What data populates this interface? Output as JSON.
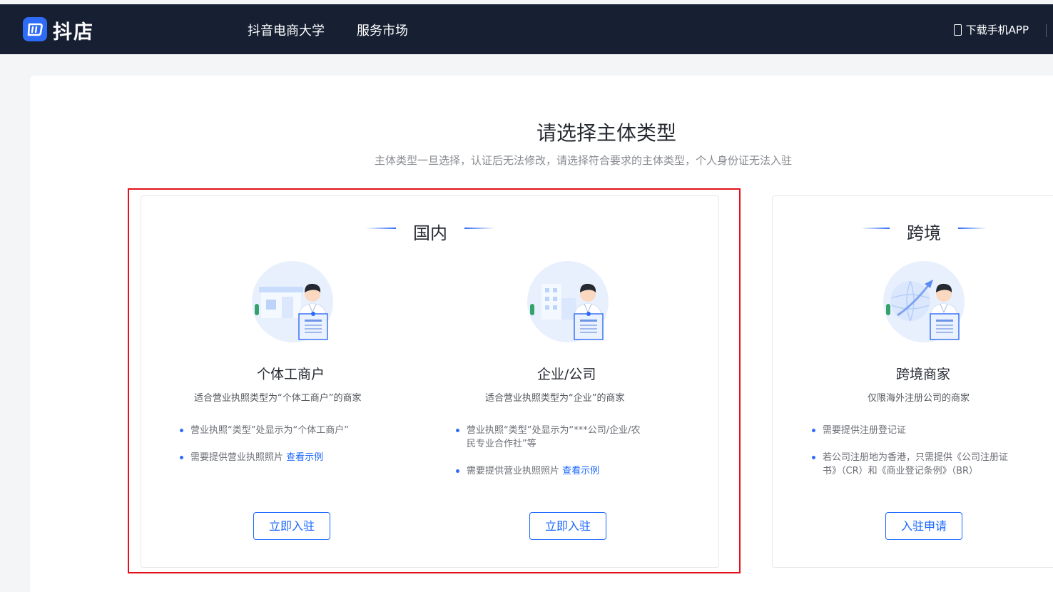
{
  "header": {
    "logo_text": "抖店",
    "nav": [
      "抖音电商大学",
      "服务市场"
    ],
    "download_label": "下载手机APP"
  },
  "page": {
    "title": "请选择主体类型",
    "subtitle": "主体类型一旦选择，认证后无法修改，请选择符合要求的主体类型，个人身份证无法入驻"
  },
  "domestic": {
    "title": "国内",
    "types": [
      {
        "name": "个体工商户",
        "desc": "适合营业执照类型为“个体工商户”的商家",
        "bullet1": "营业执照“类型”处显示为“个体工商户”",
        "bullet2": "需要提供营业执照照片",
        "link": "查看示例",
        "button": "立即入驻"
      },
      {
        "name": "企业/公司",
        "desc": "适合营业执照类型为“企业”的商家",
        "bullet1a": "营业执照“类型”处显示为“***公司/企业/农",
        "bullet1b": "民专业合作社”等",
        "bullet2": "需要提供营业执照照片",
        "link": "查看示例",
        "button": "立即入驻"
      }
    ]
  },
  "crossborder": {
    "title": "跨境",
    "name": "跨境商家",
    "desc": "仅限海外注册公司的商家",
    "bullet1": "需要提供注册登记证",
    "bullet2a": "若公司注册地为香港，只需提供《公司注册证",
    "bullet2b": "书》（CR）和《商业登记条例》（BR）",
    "button": "入驻申请"
  },
  "colors": {
    "brand": "#2e6bf6",
    "link": "#1966ff",
    "highlight": "#e30f19",
    "header_bg": "#172033"
  }
}
